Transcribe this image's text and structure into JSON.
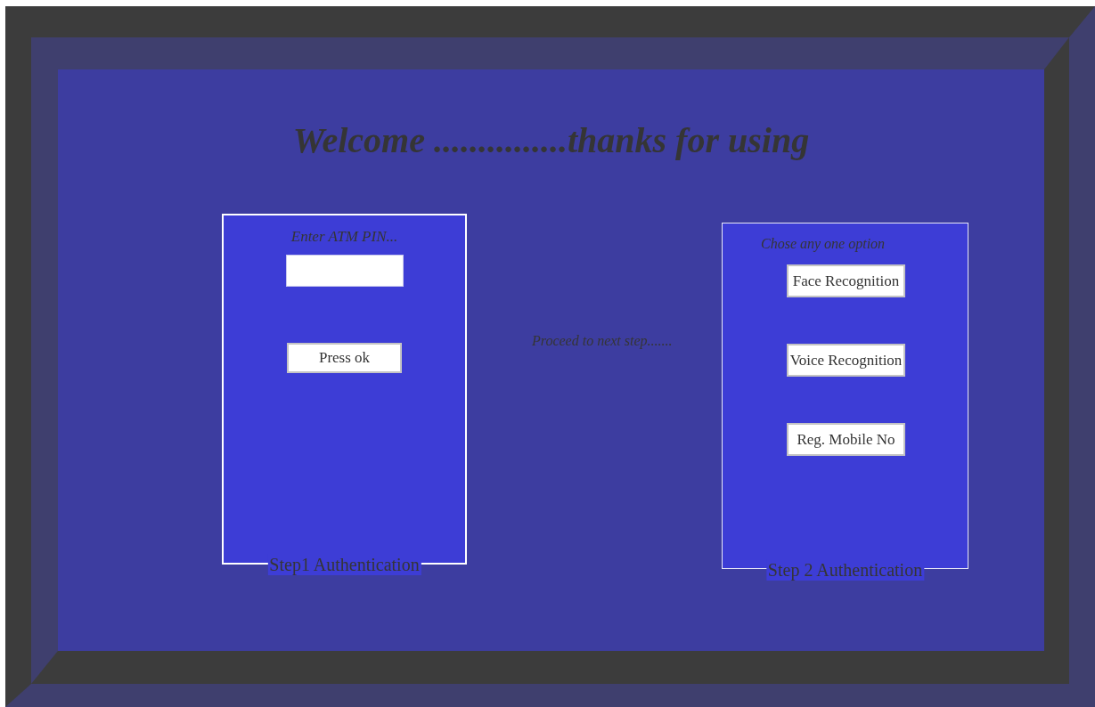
{
  "title": "Welcome ...............thanks for using",
  "step1": {
    "prompt": "Enter ATM PIN...",
    "button": "Press ok",
    "caption": "Step1 Authentication"
  },
  "middle_text": "Proceed to next step.......",
  "step2": {
    "prompt": "Chose any one option",
    "options": [
      "Face Recognition",
      "Voice Recognition",
      "Reg. Mobile No"
    ],
    "caption": "Step 2 Authentication"
  }
}
